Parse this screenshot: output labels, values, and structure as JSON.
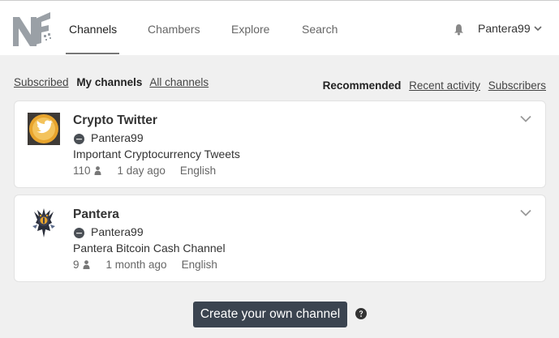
{
  "nav": {
    "items": [
      {
        "label": "Channels",
        "active": true
      },
      {
        "label": "Chambers"
      },
      {
        "label": "Explore"
      },
      {
        "label": "Search"
      }
    ],
    "user": "Pantera99",
    "logo_icon": "nf-logo-icon"
  },
  "filters": {
    "subscribed": "Subscribed",
    "my_channels": "My channels",
    "all_channels": "All channels",
    "recommended": "Recommended",
    "recent_activity": "Recent activity",
    "subscribers": "Subscribers"
  },
  "channels": [
    {
      "title": "Crypto Twitter",
      "owner": "Pantera99",
      "description": "Important Cryptocurrency Tweets",
      "subscribers": "110",
      "age": "1 day ago",
      "language": "English",
      "avatar_icon": "twitter-bird-icon"
    },
    {
      "title": "Pantera",
      "owner": "Pantera99",
      "description": "Pantera Bitcoin Cash Channel",
      "subscribers": "9",
      "age": "1 month ago",
      "language": "English",
      "avatar_icon": "panther-icon"
    }
  ],
  "create_button": "Create your own channel",
  "colors": {
    "accent": "#3b4450",
    "twitter_gold": "#e8a42c"
  }
}
